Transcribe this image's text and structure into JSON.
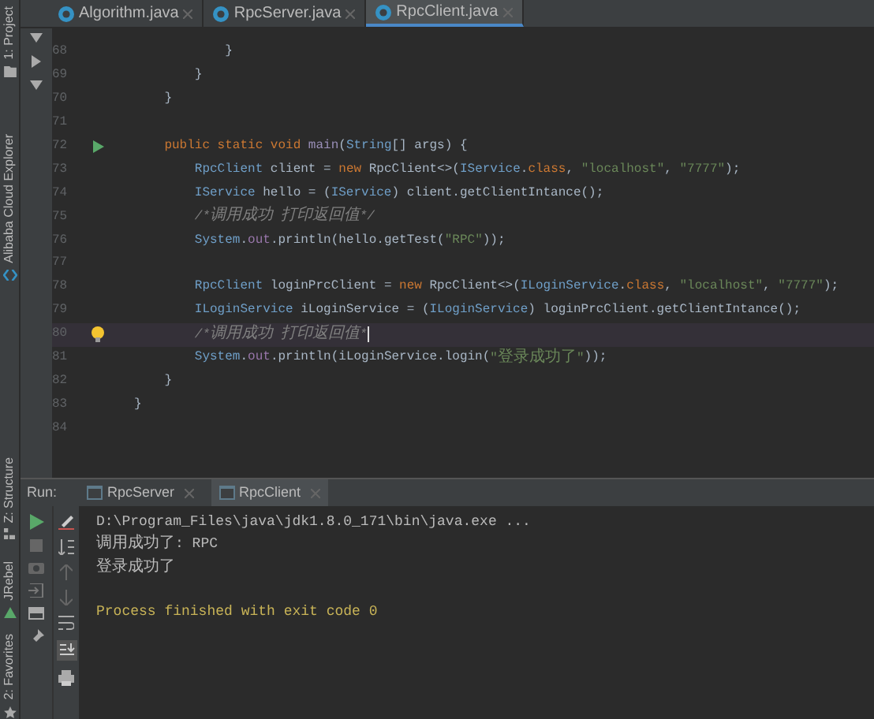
{
  "editor_tabs": [
    {
      "label": "Algorithm.java",
      "selected": false
    },
    {
      "label": "RpcServer.java",
      "selected": false
    },
    {
      "label": "RpcClient.java",
      "selected": true
    }
  ],
  "tool_windows_left": [
    {
      "label": "1: Project"
    },
    {
      "label": "Alibaba Cloud Explorer"
    },
    {
      "label": "Z: Structure"
    },
    {
      "label": "JRebel"
    },
    {
      "label": "2: Favorites"
    }
  ],
  "code_lines": [
    {
      "number": "68",
      "kind": "plain",
      "tokens": [
        {
          "text": "            }",
          "kind": "plain"
        }
      ]
    },
    {
      "number": "69",
      "kind": "plain",
      "tokens": [
        {
          "text": "        }",
          "kind": "plain"
        }
      ]
    },
    {
      "number": "70",
      "kind": "plain",
      "tokens": [
        {
          "text": "    }",
          "kind": "plain"
        }
      ]
    },
    {
      "number": "71",
      "kind": "plain"
    },
    {
      "number": "72",
      "kind": "run",
      "tokens": [
        {
          "text": "    public static void ",
          "kind": "keyword"
        },
        {
          "text": "main",
          "kind": "method"
        },
        {
          "text": "(",
          "kind": "plain"
        },
        {
          "text": "String",
          "kind": "type"
        },
        {
          "text": "[] args) {",
          "kind": "plain"
        }
      ]
    },
    {
      "number": "73",
      "kind": "plain",
      "tokens": [
        {
          "text": "        RpcClient",
          "kind": "type"
        },
        {
          "text": " client = ",
          "kind": "plain"
        },
        {
          "text": "new",
          "kind": "keyword"
        },
        {
          "text": " RpcClient<>(",
          "kind": "plain"
        },
        {
          "text": "IService",
          "kind": "type"
        },
        {
          "text": ".",
          "kind": "plain"
        },
        {
          "text": "class",
          "kind": "keyword"
        },
        {
          "text": ", ",
          "kind": "plain"
        },
        {
          "text": "\"localhost\"",
          "kind": "string"
        },
        {
          "text": ", ",
          "kind": "plain"
        },
        {
          "text": "\"7777\"",
          "kind": "string"
        },
        {
          "text": ");",
          "kind": "plain"
        }
      ]
    },
    {
      "number": "74",
      "kind": "plain",
      "tokens": [
        {
          "text": "        IService",
          "kind": "type"
        },
        {
          "text": " hello = (",
          "kind": "plain"
        },
        {
          "text": "IService",
          "kind": "type"
        },
        {
          "text": ") client.getClientIntance();",
          "kind": "plain"
        }
      ]
    },
    {
      "number": "75",
      "kind": "plain",
      "tokens": [
        {
          "text": "        /*调用成功 打印返回值*/",
          "kind": "comment"
        }
      ]
    },
    {
      "number": "76",
      "kind": "plain",
      "tokens": [
        {
          "text": "        System",
          "kind": "type"
        },
        {
          "text": ".",
          "kind": "plain"
        },
        {
          "text": "out",
          "kind": "field"
        },
        {
          "text": ".println(hello.getTest(",
          "kind": "plain"
        },
        {
          "text": "\"RPC\"",
          "kind": "string"
        },
        {
          "text": "));",
          "kind": "plain"
        }
      ]
    },
    {
      "number": "77",
      "kind": "plain"
    },
    {
      "number": "78",
      "kind": "plain",
      "tokens": [
        {
          "text": "        RpcClient",
          "kind": "type"
        },
        {
          "text": " loginPrcClient = ",
          "kind": "plain"
        },
        {
          "text": "new",
          "kind": "keyword"
        },
        {
          "text": " RpcClient<>(",
          "kind": "plain"
        },
        {
          "text": "ILoginService",
          "kind": "type"
        },
        {
          "text": ".",
          "kind": "plain"
        },
        {
          "text": "class",
          "kind": "keyword"
        },
        {
          "text": ", ",
          "kind": "plain"
        },
        {
          "text": "\"localhost\"",
          "kind": "string"
        },
        {
          "text": ", ",
          "kind": "plain"
        },
        {
          "text": "\"7777\"",
          "kind": "string"
        },
        {
          "text": ");",
          "kind": "plain"
        }
      ]
    },
    {
      "number": "79",
      "kind": "plain",
      "tokens": [
        {
          "text": "        ILoginService",
          "kind": "type"
        },
        {
          "text": " iLoginService = (",
          "kind": "plain"
        },
        {
          "text": "ILoginService",
          "kind": "type"
        },
        {
          "text": ") loginPrcClient.getClientIntance();",
          "kind": "plain"
        }
      ]
    },
    {
      "number": "80",
      "kind": "bulb",
      "current": true,
      "tokens": [
        {
          "text": "        /*调用成功 打印返回值*",
          "kind": "comment"
        }
      ]
    },
    {
      "number": "81",
      "kind": "plain",
      "tokens": [
        {
          "text": "        System",
          "kind": "type"
        },
        {
          "text": ".",
          "kind": "plain"
        },
        {
          "text": "out",
          "kind": "field"
        },
        {
          "text": ".println(iLoginService.login(",
          "kind": "plain"
        },
        {
          "text": "\"登录成功了\"",
          "kind": "string"
        },
        {
          "text": "));",
          "kind": "plain"
        }
      ]
    },
    {
      "number": "82",
      "kind": "plain",
      "tokens": [
        {
          "text": "    }",
          "kind": "plain"
        }
      ]
    },
    {
      "number": "83",
      "kind": "plain",
      "tokens": [
        {
          "text": "}",
          "kind": "plain"
        }
      ]
    },
    {
      "number": "84",
      "kind": "plain"
    }
  ],
  "run_panel": {
    "title": "Run:",
    "tabs": [
      {
        "label": "RpcServer",
        "selected": false
      },
      {
        "label": "RpcClient",
        "selected": true
      }
    ],
    "console": [
      {
        "text": "D:\\Program_Files\\java\\jdk1.8.0_171\\bin\\java.exe ...",
        "kind": "command"
      },
      {
        "text": "调用成功了: RPC",
        "kind": "output"
      },
      {
        "text": "登录成功了",
        "kind": "output"
      },
      {
        "text": "Process finished with exit code 0",
        "kind": "exit"
      }
    ]
  }
}
